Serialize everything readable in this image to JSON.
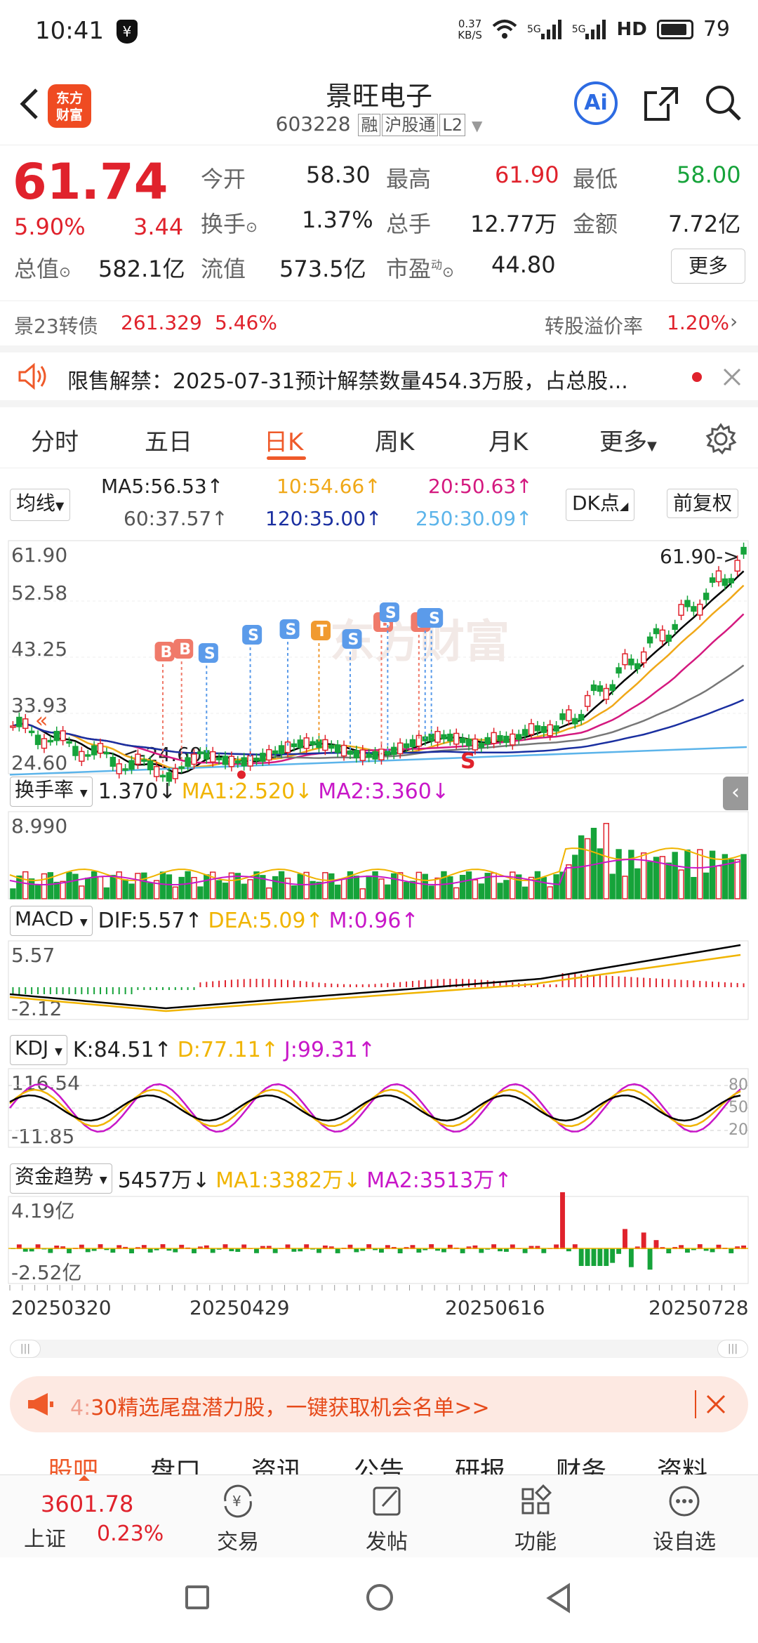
{
  "status_bar": {
    "time": "10:41",
    "net_speed_top": "0.37",
    "net_speed_bottom": "KB/S",
    "signal1": "5G",
    "signal2": "5G",
    "hd": "HD",
    "battery": "79"
  },
  "header": {
    "logo_line1": "东方",
    "logo_line2": "财富",
    "title": "景旺电子",
    "code": "603228",
    "tags": [
      "融",
      "沪股通",
      "L2"
    ],
    "ai_label": "Ai"
  },
  "quote": {
    "price": "61.74",
    "change_pct": "5.90%",
    "change": "3.44",
    "open_label": "今开",
    "open": "58.30",
    "high_label": "最高",
    "high": "61.90",
    "low_label": "最低",
    "low": "58.00",
    "turnover_label": "换手",
    "turnover": "1.37%",
    "volume_label": "总手",
    "volume": "12.77万",
    "amount_label": "金额",
    "amount": "7.72亿",
    "mktcap_label": "总值",
    "mktcap": "582.1亿",
    "float_label": "流值",
    "float": "573.5亿",
    "pe_label": "市盈",
    "pe_sup": "动",
    "pe": "44.80",
    "more_label": "更多"
  },
  "bond": {
    "name": "景23转债",
    "price": "261.329",
    "pct": "5.46%",
    "premium_label": "转股溢价率",
    "premium": "1.20%"
  },
  "notice": {
    "text": "限售解禁：2025-07-31预计解禁数量454.3万股，占总股..."
  },
  "tabs": {
    "items": [
      "分时",
      "五日",
      "日K",
      "周K",
      "月K",
      "更多"
    ],
    "active": 2
  },
  "ma": {
    "selector": "均线",
    "ma5": "MA5:56.53↑",
    "ma10": "10:54.66↑",
    "ma20": "20:50.63↑",
    "ma60": "60:37.57↑",
    "ma120": "120:35.00↑",
    "ma250": "250:30.09↑",
    "dk_button": "DK点",
    "adjust_button": "前复权",
    "colors": {
      "ma5": "#000000",
      "ma10": "#f0a818",
      "ma20": "#d4197f",
      "ma60": "#777777",
      "ma120": "#1a2fa0",
      "ma250": "#5cb4ea"
    }
  },
  "kchart": {
    "y_top": "61.90",
    "y_mid1": "52.58",
    "y_mid2": "43.25",
    "y_mid3": "33.93",
    "y_bottom": "24.60",
    "high_marker": "61.90->",
    "low_marker": "<-24.60",
    "watermark": "东方财富",
    "signal_b": "B",
    "signal_s": "S",
    "signal_t": "T"
  },
  "turnover_ind": {
    "selector": "换手率",
    "value": "1.370↓",
    "ma1": "MA1:2.520↓",
    "ma2": "MA2:3.360↓",
    "y_top": "8.990"
  },
  "macd": {
    "selector": "MACD",
    "dif": "DIF:5.57↑",
    "dea": "DEA:5.09↑",
    "m": "M:0.96↑",
    "y_top": "5.57",
    "y_bottom": "-2.12"
  },
  "kdj": {
    "selector": "KDJ",
    "k": "K:84.51↑",
    "d": "D:77.11↑",
    "j": "J:99.31↑",
    "y_top": "116.54",
    "y_bottom": "-11.85",
    "r80": "80",
    "r50": "50",
    "r20": "20"
  },
  "fund": {
    "selector": "资金趋势",
    "value": "5457万↓",
    "ma1": "MA1:3382万↓",
    "ma2": "MA2:3513万↑",
    "y_top": "4.19亿",
    "y_bottom": "-2.52亿"
  },
  "dates": [
    "20250320",
    "20250429",
    "20250616",
    "20250728"
  ],
  "promo": {
    "text_head": "4:",
    "text": "30精选尾盘潜力股，一键获取机会名单>>"
  },
  "subtabs": [
    "股吧",
    "盘口",
    "资讯",
    "公告",
    "研报",
    "财务",
    "资料"
  ],
  "bottom": {
    "index_value": "3601.78",
    "index_name": "上证",
    "index_pct": "0.23%",
    "items": [
      "交易",
      "发帖",
      "功能",
      "设自选"
    ]
  }
}
